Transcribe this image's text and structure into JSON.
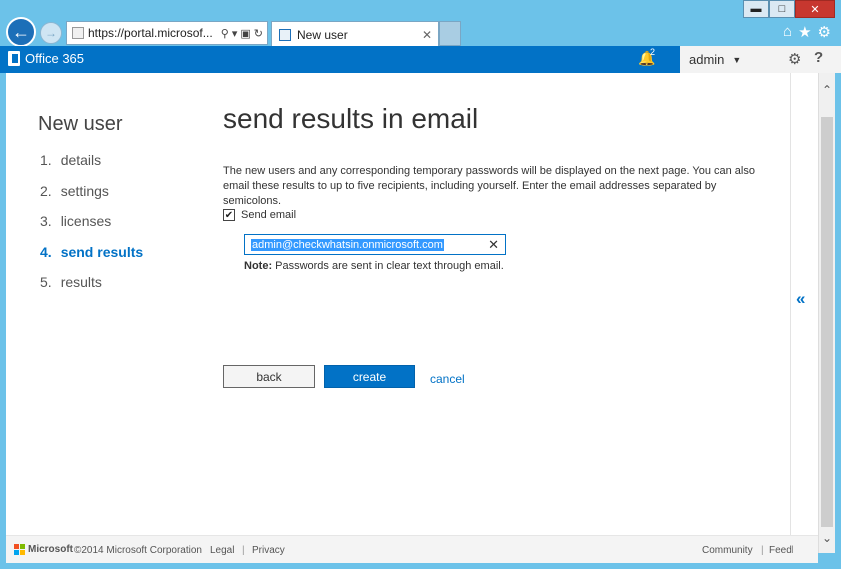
{
  "browser": {
    "url": "https://portal.microsof...",
    "tab_title": "New user",
    "close_tab_glyph": "✕",
    "window_controls": {
      "minimize": "▬",
      "maximize": "□",
      "close": "✕"
    }
  },
  "suite_bar": {
    "brand": "Office 365",
    "notification_count": "2",
    "user_menu_label": "admin"
  },
  "wizard": {
    "title": "New user",
    "steps": [
      {
        "number": "1.",
        "label": "details"
      },
      {
        "number": "2.",
        "label": "settings"
      },
      {
        "number": "3.",
        "label": "licenses"
      },
      {
        "number": "4.",
        "label": "send results"
      },
      {
        "number": "5.",
        "label": "results"
      }
    ],
    "active_step": 4
  },
  "content": {
    "title": "send results in email",
    "description": "The new users and any corresponding temporary passwords will be displayed on the next page. You can also email these results to up to five recipients, including yourself. Enter the email addresses separated by semicolons.",
    "send_email_label": "Send email",
    "send_email_checked": true,
    "email_value": "admin@checkwhatsin.onmicrosoft.com",
    "note_label": "Note:",
    "note_text": "Passwords are sent in clear text through email."
  },
  "buttons": {
    "back": "back",
    "create": "create",
    "cancel": "cancel"
  },
  "footer": {
    "brand": "Microsoft",
    "copyright": "©2014 Microsoft Corporation",
    "legal": "Legal",
    "separator": "|",
    "privacy": "Privacy",
    "community": "Community",
    "feedback": "Feedback"
  },
  "colors": {
    "accent": "#0272c6",
    "chrome": "#6cc2e9",
    "selection": "#3399ff"
  }
}
